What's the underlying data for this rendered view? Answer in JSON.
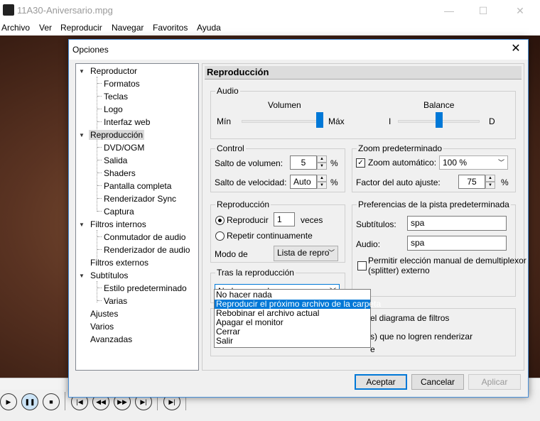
{
  "window": {
    "title": "11A30-Aniversario.mpg"
  },
  "menu": [
    "Archivo",
    "Ver",
    "Reproducir",
    "Navegar",
    "Favoritos",
    "Ayuda"
  ],
  "dialog": {
    "title": "Opciones",
    "tree": [
      {
        "label": "Reproductor"
      },
      {
        "label": "Formatos"
      },
      {
        "label": "Teclas"
      },
      {
        "label": "Logo"
      },
      {
        "label": "Interfaz web"
      },
      {
        "label": "Reproducción",
        "selected": true
      },
      {
        "label": "DVD/OGM"
      },
      {
        "label": "Salida"
      },
      {
        "label": "Shaders"
      },
      {
        "label": "Pantalla completa"
      },
      {
        "label": "Renderizador Sync"
      },
      {
        "label": "Captura"
      },
      {
        "label": "Filtros internos"
      },
      {
        "label": "Conmutador de audio"
      },
      {
        "label": "Renderizador de audio"
      },
      {
        "label": "Filtros externos"
      },
      {
        "label": "Subtítulos"
      },
      {
        "label": "Estilo predeterminado"
      },
      {
        "label": "Varias"
      },
      {
        "label": "Ajustes"
      },
      {
        "label": "Varios"
      },
      {
        "label": "Avanzadas"
      }
    ],
    "panel_title": "Reproducción",
    "audio": {
      "group": "Audio",
      "volume_label": "Volumen",
      "min": "Mín",
      "max": "Máx",
      "balance_label": "Balance",
      "left": "I",
      "right": "D",
      "volume_level": 1.0,
      "balance_level": 0.5
    },
    "control": {
      "group": "Control",
      "volume_step_label": "Salto de volumen:",
      "volume_step": "5",
      "volume_unit": "%",
      "speed_step_label": "Salto de velocidad:",
      "speed_step": "Auto",
      "speed_unit": "%"
    },
    "zoom": {
      "group": "Zoom predeterminado",
      "auto_label": "Zoom automático:",
      "auto_checked": "✓",
      "auto_value": "100 %",
      "factor_label": "Factor del auto ajuste:",
      "factor_value": "75",
      "factor_unit": "%"
    },
    "playback": {
      "group": "Reproducción",
      "play_label": "Reproducir",
      "play_count": "1",
      "times": "veces",
      "repeat_label": "Repetir continuamente",
      "mode_label": "Modo de",
      "mode_value": "Lista de repro"
    },
    "tracks": {
      "group": "Preferencias de la pista predeterminada",
      "subtitles_label": "Subtítulos:",
      "subtitles_value": "spa",
      "audio_label": "Audio:",
      "audio_value": "spa",
      "splitter_line1": "Permitir elección manual de demultiplexor",
      "splitter_line2": "(splitter) externo"
    },
    "after": {
      "group": "Tras la reproducción",
      "selected": "No hacer nada",
      "options": [
        "No hacer nada",
        "Reproducir el próximo archivo de la carpeta",
        "Rebobinar el archivo actual",
        "Apagar el monitor",
        "Cerrar",
        "Salir"
      ],
      "highlighted_index": 1
    },
    "hidden_group": {
      "line1": "el diagrama de filtros",
      "line2": "s) que no logren renderizar",
      "line3": "e"
    },
    "buttons": {
      "ok": "Aceptar",
      "cancel": "Cancelar",
      "apply": "Aplicar"
    }
  }
}
